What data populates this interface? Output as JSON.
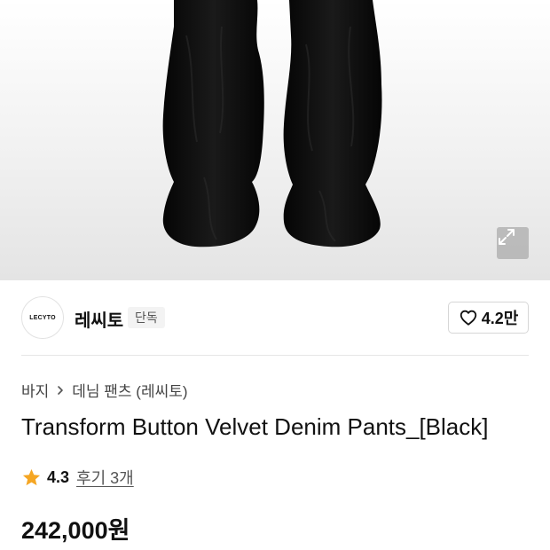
{
  "brand": {
    "logo_text": "LECYTO",
    "name": "레씨토",
    "badge": "단독"
  },
  "like": {
    "icon": "heart-outline-icon",
    "count": "4.2만"
  },
  "breadcrumb": {
    "items": [
      "바지",
      "데님 팬츠 (레씨토)"
    ],
    "separator_icon": "chevron-right-icon"
  },
  "product": {
    "title": "Transform Button Velvet Denim Pants_[Black]",
    "rating": "4.3",
    "review_link": "후기 3개",
    "price": "242,000원"
  },
  "colors": {
    "star": "#f5a623",
    "pants": "#0b0b0b"
  },
  "icons": {
    "expand": "expand-arrows-icon",
    "star": "star-icon"
  }
}
